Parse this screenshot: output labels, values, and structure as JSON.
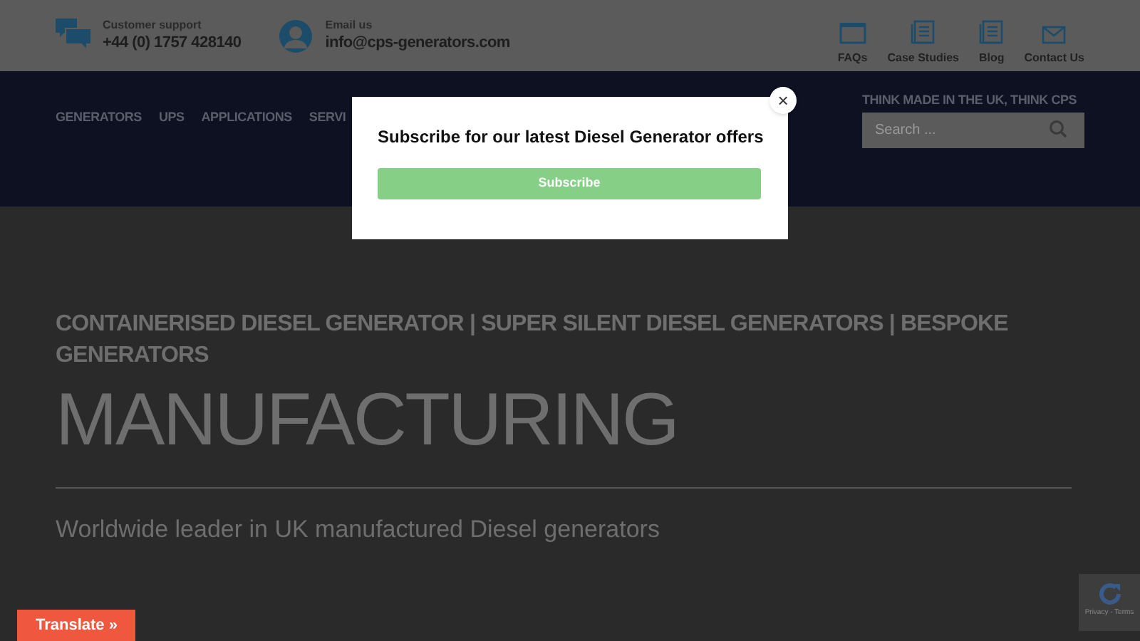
{
  "contact": [
    {
      "kind": "chat",
      "label": "Customer support",
      "value": "+44 (0) 1757 428140"
    },
    {
      "kind": "user",
      "label": "Email us",
      "value": "info@cps-generators.com"
    }
  ],
  "quick_links": [
    {
      "kind": "folder",
      "label": "FAQs"
    },
    {
      "kind": "doc",
      "label": "Case Studies"
    },
    {
      "kind": "doc",
      "label": "Blog"
    },
    {
      "kind": "mail",
      "label": "Contact Us"
    }
  ],
  "nav": [
    "GENERATORS",
    "UPS",
    "APPLICATIONS",
    "SERVI"
  ],
  "tagline": "THINK MADE IN THE UK, THINK CPS",
  "search": {
    "placeholder": "Search ..."
  },
  "hero": {
    "subtitle": "CONTAINERISED DIESEL GENERATOR | SUPER SILENT DIESEL GENERATORS | BESPOKE GENERATORS",
    "title": "MANUFACTURING",
    "text": "Worldwide leader in UK manufactured Diesel generators"
  },
  "modal": {
    "title": "Subscribe for our latest Diesel Generator offers",
    "button": "Subscribe",
    "close": "×"
  },
  "translate": "Translate »",
  "recaptcha": "Privacy - Terms"
}
